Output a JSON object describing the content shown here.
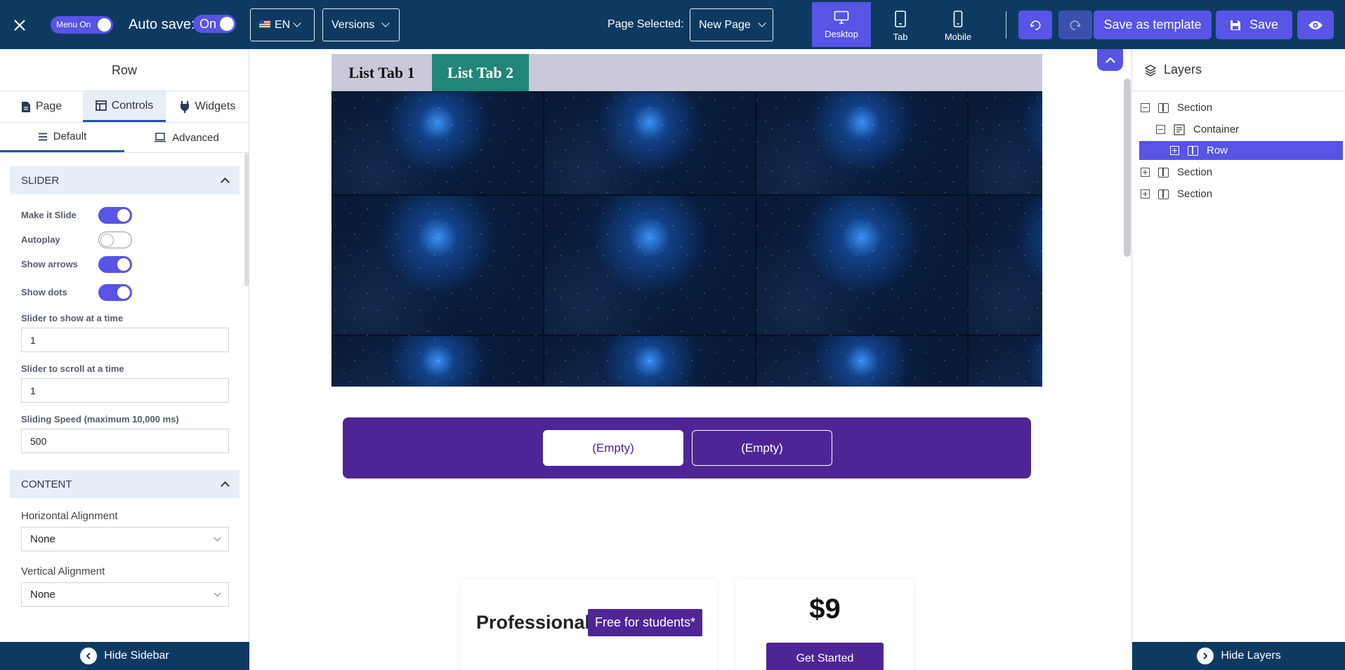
{
  "topbar": {
    "menu_toggle_label": "Menu On",
    "autosave_label": "Auto save:",
    "autosave_value": "On",
    "language": "EN",
    "versions_label": "Versions",
    "page_selected_label": "Page Selected:",
    "page_selected_value": "New Page",
    "devices": [
      {
        "label": "Desktop",
        "active": true
      },
      {
        "label": "Tab",
        "active": false
      },
      {
        "label": "Mobile",
        "active": false
      }
    ],
    "save_template_label": "Save as template",
    "save_label": "Save"
  },
  "sidebar": {
    "title": "Row",
    "tabs": [
      {
        "label": "Page",
        "icon": "document-icon"
      },
      {
        "label": "Controls",
        "icon": "layout-icon",
        "active": true
      },
      {
        "label": "Widgets",
        "icon": "plug-icon"
      }
    ],
    "sub_tabs": [
      {
        "label": "Default",
        "icon": "list-icon",
        "active": true
      },
      {
        "label": "Advanced",
        "icon": "laptop-icon"
      }
    ],
    "slider_panel": {
      "title": "SLIDER",
      "toggles": [
        {
          "label": "Make it Slide",
          "on": true
        },
        {
          "label": "Autoplay",
          "on": false
        },
        {
          "label": "Show arrows",
          "on": true
        },
        {
          "label": "Show dots",
          "on": true
        }
      ],
      "slides_to_show_label": "Slider to show at a time",
      "slides_to_show_value": "1",
      "slides_to_scroll_label": "Slider to scroll at a time",
      "slides_to_scroll_value": "1",
      "speed_label": "Sliding Speed (maximum 10,000 ms)",
      "speed_value": "500"
    },
    "content_panel": {
      "title": "CONTENT",
      "horizontal_label": "Horizontal Alignment",
      "horizontal_value": "None",
      "vertical_label": "Vertical Alignment",
      "vertical_value": "None"
    },
    "footer_label": "Hide Sidebar"
  },
  "canvas": {
    "list_tabs": [
      "List Tab 1",
      "List Tab 2"
    ],
    "empty_buttons": [
      "(Empty)",
      "(Empty)"
    ],
    "pricing": {
      "plan_title": "Professional",
      "badge": "Free for students*",
      "price": "$9",
      "cta": "Get Started"
    }
  },
  "layers": {
    "title": "Layers",
    "items": [
      {
        "label": "Section",
        "expanded": true
      },
      {
        "label": "Container",
        "expanded": true
      },
      {
        "label": "Row",
        "expanded": false,
        "selected": true
      },
      {
        "label": "Section",
        "expanded": false
      },
      {
        "label": "Section",
        "expanded": false
      }
    ],
    "footer_label": "Hide Layers"
  },
  "colors": {
    "topbar": "#0e3a62",
    "accent": "#5754e6",
    "tab_active": "#22857a",
    "purple": "#4f2596"
  }
}
